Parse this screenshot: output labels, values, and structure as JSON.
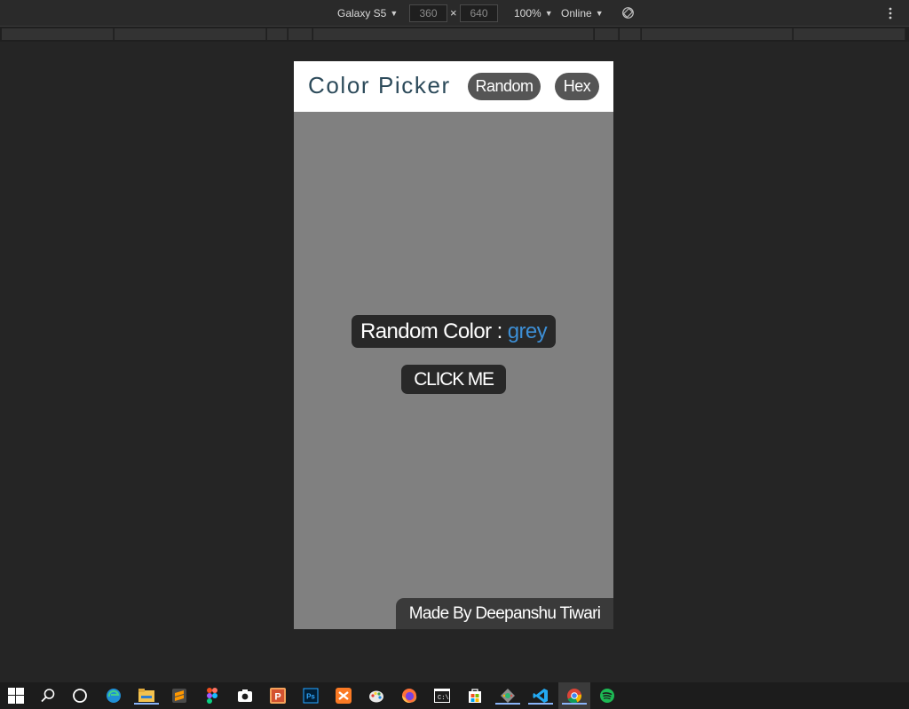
{
  "devtools": {
    "device_name": "Galaxy S5",
    "width": "360",
    "height": "640",
    "zoom": "100%",
    "network": "Online",
    "times_symbol": "×",
    "caret": "▼"
  },
  "app": {
    "title": "Color Picker",
    "nav": {
      "random_label": "Random",
      "hex_label": "Hex"
    },
    "color_label_prefix": "Random Color :",
    "color_value": "grey",
    "click_button_label": "CLICK ME",
    "credit": "Made By Deepanshu Tiwari",
    "colors": {
      "background": "#808080",
      "value_text": "#3d8fd6",
      "header_text": "#2c4a5a"
    }
  },
  "taskbar": {
    "items": [
      "windows-start-icon",
      "search-icon",
      "cortana-icon",
      "edge-icon",
      "file-explorer-icon",
      "sublime-text-icon",
      "figma-icon",
      "camera-icon",
      "powerpoint-icon",
      "photoshop-icon",
      "xampp-icon",
      "paint-icon",
      "firefox-icon",
      "command-prompt-icon",
      "store-icon",
      "gitkraken-icon",
      "vscode-icon",
      "chrome-icon",
      "spotify-icon"
    ]
  }
}
